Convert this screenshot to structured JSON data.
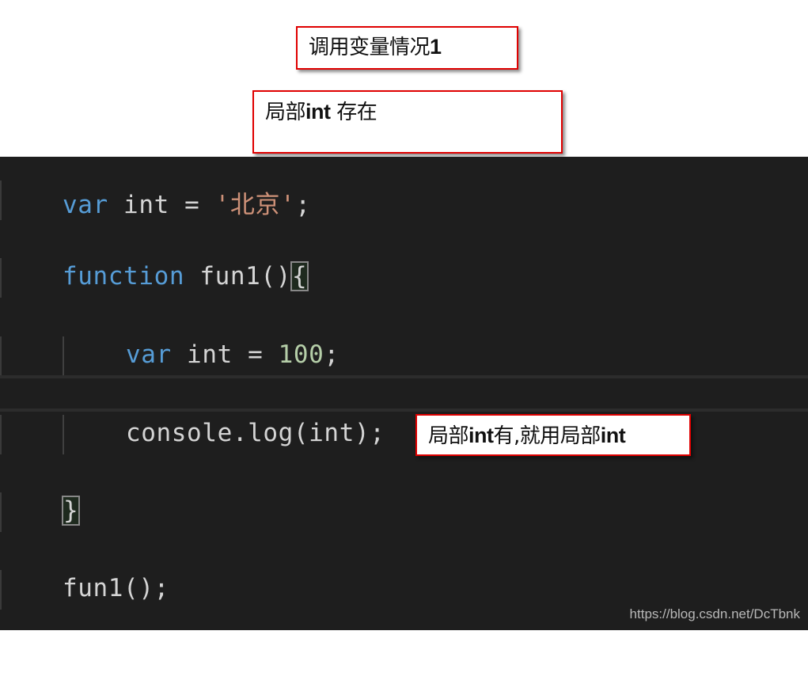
{
  "annotations": {
    "title_note": {
      "text": "调用变量情况",
      "suffix": "1"
    },
    "scope_note": {
      "prefix": "局部",
      "bold": "int",
      "suffix": " 存在"
    },
    "log_note": {
      "prefix": "局部",
      "bold1": "int",
      "middle": "有,就用局部",
      "bold2": "int"
    }
  },
  "editor": {
    "background": "#1e1e1e",
    "colors": {
      "keyword": "#569cd6",
      "string": "#ce9178",
      "number": "#b5cea8",
      "text": "#d4d4d4"
    },
    "lines": [
      {
        "kw": "var",
        "rest1": " int = ",
        "str": "'北京'",
        "rest2": ";"
      },
      {
        "kw": "function",
        "rest1": " fun1()",
        "brace": "{"
      },
      {
        "kw": "var",
        "rest1": " int = ",
        "num": "100",
        "rest2": ";"
      },
      {
        "text": ""
      },
      {
        "text": "console.log(int);"
      },
      {
        "brace": "}"
      },
      {
        "text": "fun1();"
      }
    ]
  },
  "watermark": "https://blog.csdn.net/DcTbnk"
}
